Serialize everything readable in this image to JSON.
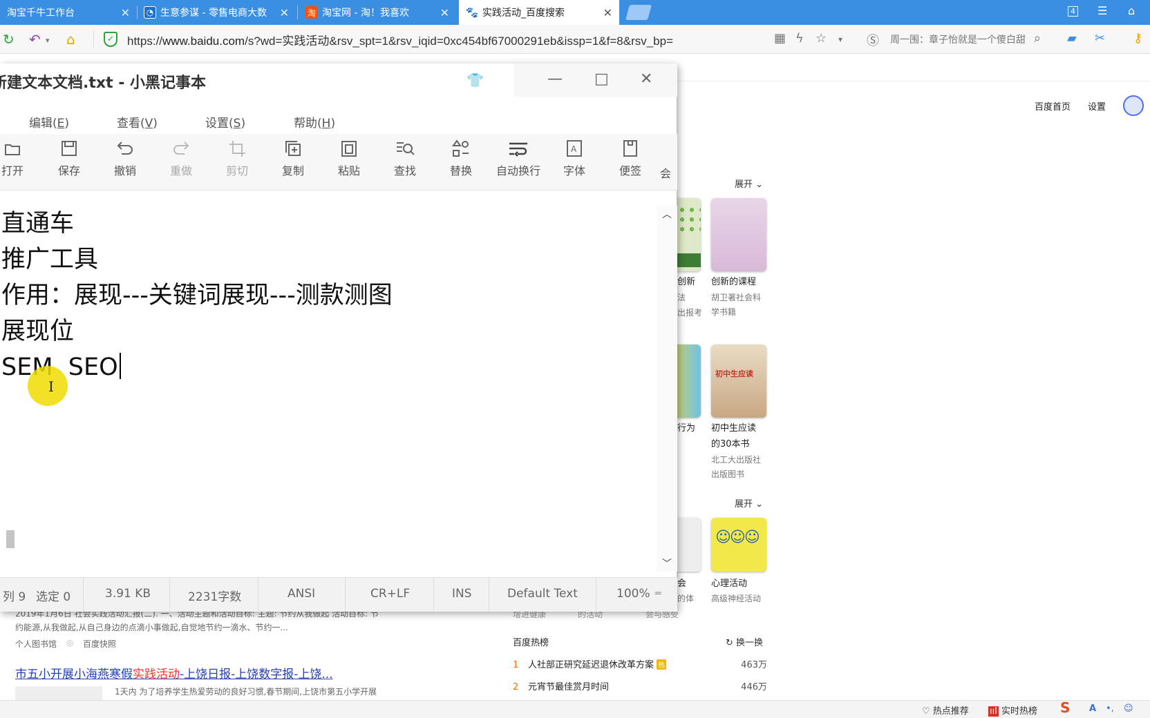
{
  "browser": {
    "tabs": [
      {
        "title": "淘宝千牛工作台",
        "icon": "qianniu-icon"
      },
      {
        "title": "生意参谋 - 零售电商大数",
        "icon": "shengyi-icon"
      },
      {
        "title": "淘宝网 - 淘！我喜欢",
        "icon": "taobao-icon",
        "fav_text": "淘"
      },
      {
        "title": "实践活动_百度搜索",
        "icon": "baidu-paw-icon",
        "active": true
      }
    ],
    "tab_count_badge": "4",
    "url_prefix": "https://",
    "url_host": "www.baidu.com",
    "url_rest": "/s?wd=实践活动&rsv_spt=1&rsv_iqid=0xc454bf67000291eb&issp=1&f=8&rsv_bp=",
    "news_ticker": "周一围：章子怡就是一个傻白甜"
  },
  "baidu": {
    "top_links": [
      "百度首页",
      "设置"
    ],
    "expand_label": "展开",
    "books_row1": [
      {
        "title_partial": "创新",
        "sub_partial": "法",
        "sub2_partial": "出报考"
      },
      {
        "title": "创新的课程",
        "sub": "胡卫著社会科",
        "sub2": "学书籍"
      }
    ],
    "books_row2": [
      {
        "title_partial": "行为"
      },
      {
        "title": "初中生应读",
        "title2": "的30本书",
        "sub": "北工大出版社",
        "sub2": "出版图书"
      }
    ],
    "books_row3": [
      {
        "title_partial": "会",
        "sub_partial": "的体"
      },
      {
        "title": "心理活动",
        "sub": "高级神经活动"
      }
    ],
    "partial_labels_row": [
      "增进健康",
      "的活动",
      "会与感受"
    ],
    "result_snippet_1": "2019年1月6日 社会实践活动汇报(二). 一、活动主题和活动目标: 主题: 节约从我做起 活动目标: 节",
    "result_snippet_2": "约能源,从我做起,从自己身边的点滴小事做起,自觉地节约一滴水、节约一...",
    "result_source": "个人图书馆",
    "result_cache": "百度快照",
    "result2_title_pre": "市五小开展小海燕寒假",
    "result2_title_hl": "实践活动",
    "result2_title_post": "-上饶日报-上饶数字报-上饶...",
    "result2_snippet": "1天内 为了培养学生热爱劳动的良好习惯,春节期间,上饶市第五小学开展",
    "hot_title": "百度热榜",
    "hot_refresh": "换一换",
    "hot_items": [
      {
        "rank": "1",
        "text": "人社部正研究延迟退休改革方案",
        "badge": "热",
        "count": "463万"
      },
      {
        "rank": "2",
        "text": "元宵节最佳赏月时间",
        "count": "446万"
      }
    ]
  },
  "bottom_bar": {
    "items": [
      "热点推荐",
      "实时热榜"
    ]
  },
  "notepad": {
    "title": "新建文本文档.txt - 小黑记事本",
    "menu": [
      {
        "label": "编辑(",
        "key": "E",
        "end": ")"
      },
      {
        "label": "查看(",
        "key": "V",
        "end": ")"
      },
      {
        "label": "设置(",
        "key": "S",
        "end": ")"
      },
      {
        "label": "帮助(",
        "key": "H",
        "end": ")"
      }
    ],
    "toolbar": [
      "打开",
      "保存",
      "撤销",
      "重做",
      "剪切",
      "复制",
      "粘贴",
      "查找",
      "替换",
      "自动换行",
      "字体",
      "便签",
      "会"
    ],
    "lines": [
      "直通车",
      "推广工具",
      "作用：展现---关键词展现---测款测图",
      "展现位",
      "SEM  SEO"
    ],
    "status": {
      "position": "列 9",
      "selection": "选定 0",
      "size": "3.91 KB",
      "chars": "2231字数",
      "encoding": "ANSI",
      "line_ending": "CR+LF",
      "mode": "INS",
      "highlight": "Default Text",
      "zoom": "100%"
    }
  },
  "colors": {
    "tabbar": "#3b8fe3",
    "link": "#2440b3",
    "highlight": "#f73131",
    "cursor_highlight": "#f0dc00"
  }
}
